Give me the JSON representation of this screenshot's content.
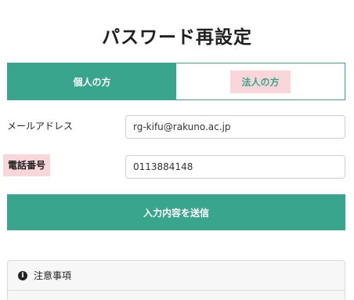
{
  "page": {
    "title": "パスワード再設定"
  },
  "tabs": [
    {
      "label": "個人の方",
      "active": true
    },
    {
      "label": "法人の方",
      "active": false
    }
  ],
  "form": {
    "email_label": "メールアドレス",
    "email_value": "rg-kifu@rakuno.ac.jp",
    "phone_label": "電話番号",
    "phone_value": "0113884148",
    "submit_label": "入力内容を送信"
  },
  "notice": {
    "title": "注意事項",
    "icon": "info-icon"
  },
  "colors": {
    "accent": "#3aa58d",
    "highlight": "#f9d6d9"
  }
}
